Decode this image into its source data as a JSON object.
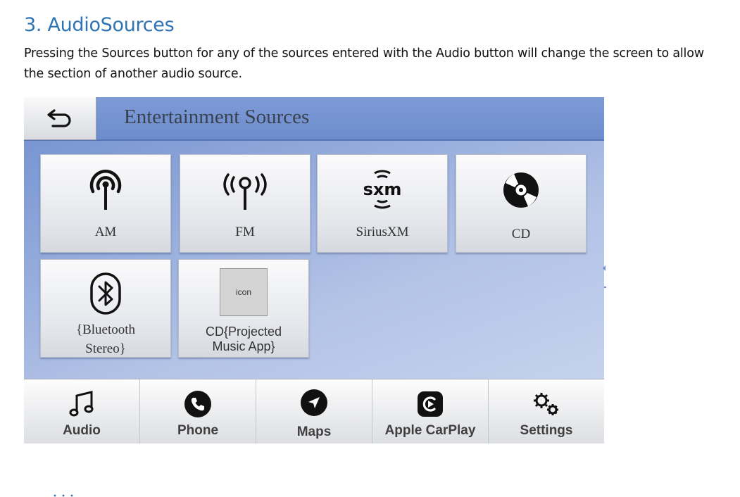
{
  "document": {
    "heading": "3. AudioSources",
    "paragraph": "Pressing the Sources button for any of the sources entered with the Audio button will change the screen to allow the section of another audio source."
  },
  "screen": {
    "title": "Entertainment Sources",
    "back_icon": "back-arrow-icon",
    "sources": [
      {
        "label": "AM",
        "icon": "am-antenna-icon"
      },
      {
        "label": "FM",
        "icon": "fm-antenna-icon"
      },
      {
        "label": "SiriusXM",
        "icon": "siriusxm-logo-icon"
      },
      {
        "label": "CD",
        "icon": "cd-disc-icon"
      },
      {
        "label_line1": "{Bluetooth",
        "label_line2": "Stereo}",
        "icon": "bluetooth-icon"
      },
      {
        "label_line1": "CD{Projected",
        "label_line2": "Music App}",
        "icon_placeholder": "icon"
      }
    ],
    "nav": [
      {
        "label": "Audio",
        "icon": "music-note-icon"
      },
      {
        "label": "Phone",
        "icon": "phone-icon"
      },
      {
        "label": "Maps",
        "icon": "navigation-arrow-icon"
      },
      {
        "label": "Apple CarPlay",
        "icon": "carplay-icon"
      },
      {
        "label": "Settings",
        "icon": "gears-icon"
      }
    ],
    "colors": {
      "background_top": "#6f8fcf",
      "background_bottom": "#c5d2ee",
      "heading": "#2e74b5"
    }
  }
}
